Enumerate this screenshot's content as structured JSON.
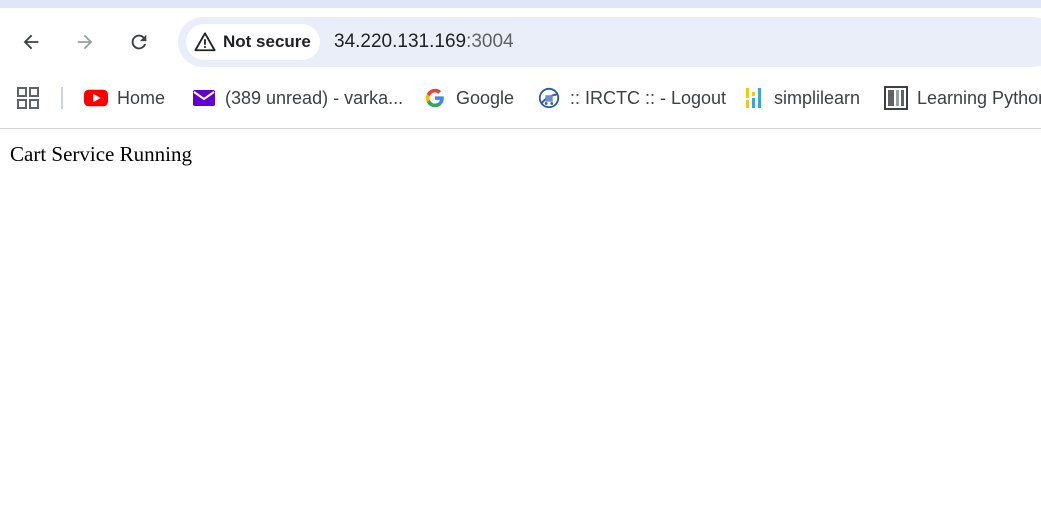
{
  "browser": {
    "omnibox": {
      "security_label": "Not secure",
      "url_host": "34.220.131.169",
      "url_port": ":3004"
    },
    "bookmarks": [
      {
        "label": "Home",
        "icon": "youtube-icon"
      },
      {
        "label": "(389 unread) - varka...",
        "icon": "yahoo-mail-icon"
      },
      {
        "label": "Google",
        "icon": "google-icon"
      },
      {
        "label": ":: IRCTC :: - Logout",
        "icon": "irctc-icon"
      },
      {
        "label": "simplilearn",
        "icon": "simplilearn-icon"
      },
      {
        "label": "Learning Python",
        "icon": "book-icon"
      }
    ],
    "colors": {
      "youtube": "#ff0000",
      "yahoo": "#6001d2",
      "simplilearn_yellow": "#f4c51a",
      "simplilearn_blue": "#3aa3e3"
    }
  },
  "page": {
    "text": "Cart Service Running"
  }
}
